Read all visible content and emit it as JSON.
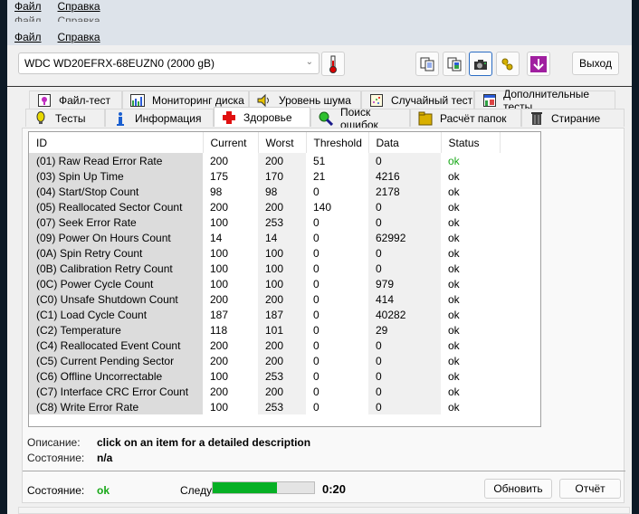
{
  "menu": {
    "file": "Файл",
    "help": "Справка"
  },
  "toolbar": {
    "drive": "WDC WD20EFRX-68EUZN0 (2000 gB)",
    "icons": [
      "thermometer-icon",
      "copy-text-icon",
      "copy-image-icon",
      "camera-icon",
      "keys-icon",
      "download-icon"
    ],
    "exit_label": "Выход"
  },
  "tabs": {
    "row1": [
      {
        "label": "Файл-тест",
        "icon": "file-test-icon"
      },
      {
        "label": "Мониторинг диска",
        "icon": "monitor-chart-icon"
      },
      {
        "label": "Уровень шума",
        "icon": "speaker-icon"
      },
      {
        "label": "Случайный тест",
        "icon": "random-test-icon"
      },
      {
        "label": "Дополнительные тесты",
        "icon": "extra-tests-icon"
      }
    ],
    "row2": [
      {
        "label": "Тесты",
        "icon": "bulb-icon"
      },
      {
        "label": "Информация",
        "icon": "info-icon"
      },
      {
        "label": "Здоровье",
        "icon": "health-cross-icon",
        "selected": true
      },
      {
        "label": "Поиск ошибок",
        "icon": "magnifier-icon"
      },
      {
        "label": "Расчёт папок",
        "icon": "folder-icon"
      },
      {
        "label": "Стирание",
        "icon": "trash-icon"
      }
    ]
  },
  "smart": {
    "columns": [
      "ID",
      "Current",
      "Worst",
      "Threshold",
      "Data",
      "Status"
    ],
    "rows": [
      [
        "(01) Raw Read Error Rate",
        "200",
        "200",
        "51",
        "0",
        "ok"
      ],
      [
        "(03) Spin Up Time",
        "175",
        "170",
        "21",
        "4216",
        "ok"
      ],
      [
        "(04) Start/Stop Count",
        "98",
        "98",
        "0",
        "2178",
        "ok"
      ],
      [
        "(05) Reallocated Sector Count",
        "200",
        "200",
        "140",
        "0",
        "ok"
      ],
      [
        "(07) Seek Error Rate",
        "100",
        "253",
        "0",
        "0",
        "ok"
      ],
      [
        "(09) Power On Hours Count",
        "14",
        "14",
        "0",
        "62992",
        "ok"
      ],
      [
        "(0A) Spin Retry Count",
        "100",
        "100",
        "0",
        "0",
        "ok"
      ],
      [
        "(0B) Calibration Retry Count",
        "100",
        "100",
        "0",
        "0",
        "ok"
      ],
      [
        "(0C) Power Cycle Count",
        "100",
        "100",
        "0",
        "979",
        "ok"
      ],
      [
        "(C0) Unsafe Shutdown Count",
        "200",
        "200",
        "0",
        "414",
        "ok"
      ],
      [
        "(C1) Load Cycle Count",
        "187",
        "187",
        "0",
        "40282",
        "ok"
      ],
      [
        "(C2) Temperature",
        "118",
        "101",
        "0",
        "29",
        "ok"
      ],
      [
        "(C4) Reallocated Event Count",
        "200",
        "200",
        "0",
        "0",
        "ok"
      ],
      [
        "(C5) Current Pending Sector",
        "200",
        "200",
        "0",
        "0",
        "ok"
      ],
      [
        "(C6) Offline Uncorrectable",
        "100",
        "253",
        "0",
        "0",
        "ok"
      ],
      [
        "(C7) Interface CRC Error Count",
        "200",
        "200",
        "0",
        "0",
        "ok"
      ],
      [
        "(C8) Write Error Rate",
        "100",
        "253",
        "0",
        "0",
        "ok"
      ]
    ]
  },
  "details": {
    "description_label": "Описание:",
    "description_value": "click on an item for a detailed description",
    "state_label": "Состояние:",
    "state_value": "n/a"
  },
  "footer": {
    "status_label": "Состояние:",
    "status_value": "ok",
    "status_color": "#18a818",
    "next_label": "Следующая проверка",
    "progress_percent": 63,
    "timer": "0:20",
    "refresh_label": "Обновить",
    "report_label": "Отчёт"
  }
}
